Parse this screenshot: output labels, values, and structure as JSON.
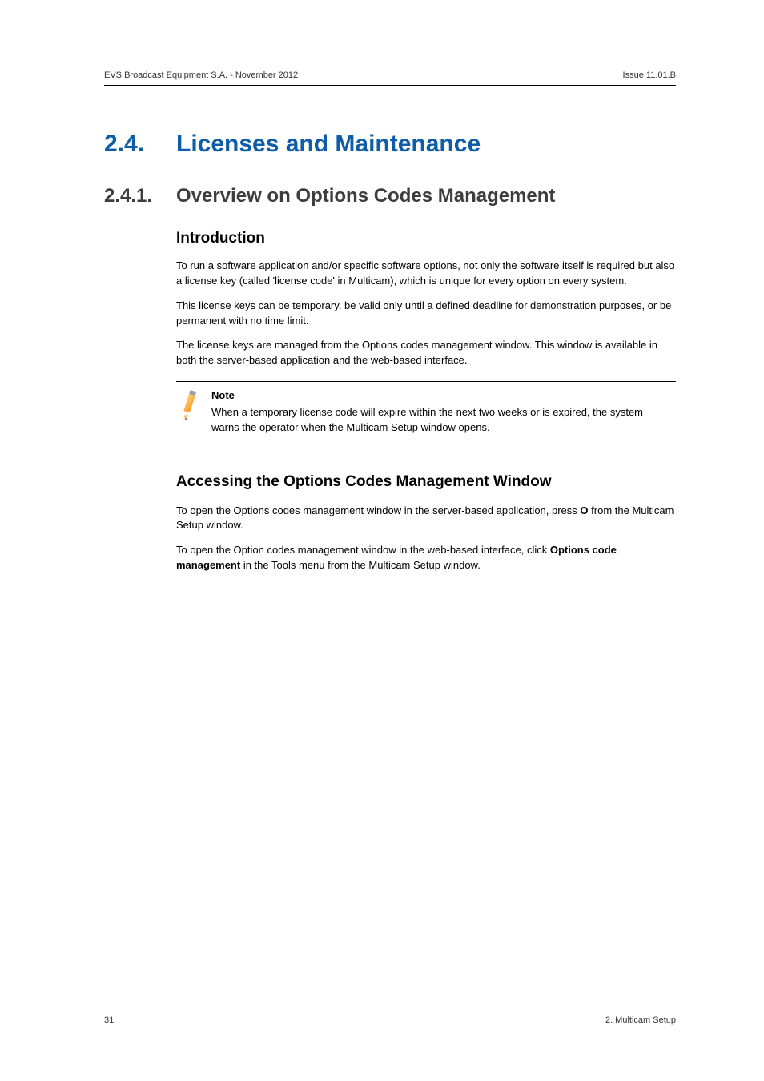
{
  "header": {
    "left": "EVS Broadcast Equipment S.A.  - November 2012",
    "right": "Issue 11.01.B"
  },
  "chapter": {
    "number": "2.4.",
    "title": "Licenses and Maintenance"
  },
  "section": {
    "number": "2.4.1.",
    "title": "Overview on Options Codes Management"
  },
  "intro": {
    "heading": "Introduction",
    "p1": "To run a software application and/or specific software options, not only the software itself is required but also a license key (called 'license code' in Multicam), which is unique for every option on every system.",
    "p2": "This license keys can be temporary, be valid only until a defined deadline for demonstration purposes, or be permanent with no time limit.",
    "p3": "The license keys are managed from the Options codes management window. This window is available in both the server-based application and the web-based interface."
  },
  "note": {
    "label": "Note",
    "body": "When a temporary license code will expire within the next two weeks or is expired, the system warns the operator when the Multicam Setup window opens."
  },
  "access": {
    "heading": "Accessing the Options Codes Management Window",
    "p1_a": "To open the Options codes management window in the server-based application, press ",
    "p1_b": "O",
    "p1_c": " from the Multicam Setup window.",
    "p2_a": "To open the Option codes management window in the web-based interface, click ",
    "p2_b": "Options code management",
    "p2_c": " in the Tools menu from the Multicam Setup window."
  },
  "footer": {
    "left": "31",
    "right": "2. Multicam Setup"
  }
}
